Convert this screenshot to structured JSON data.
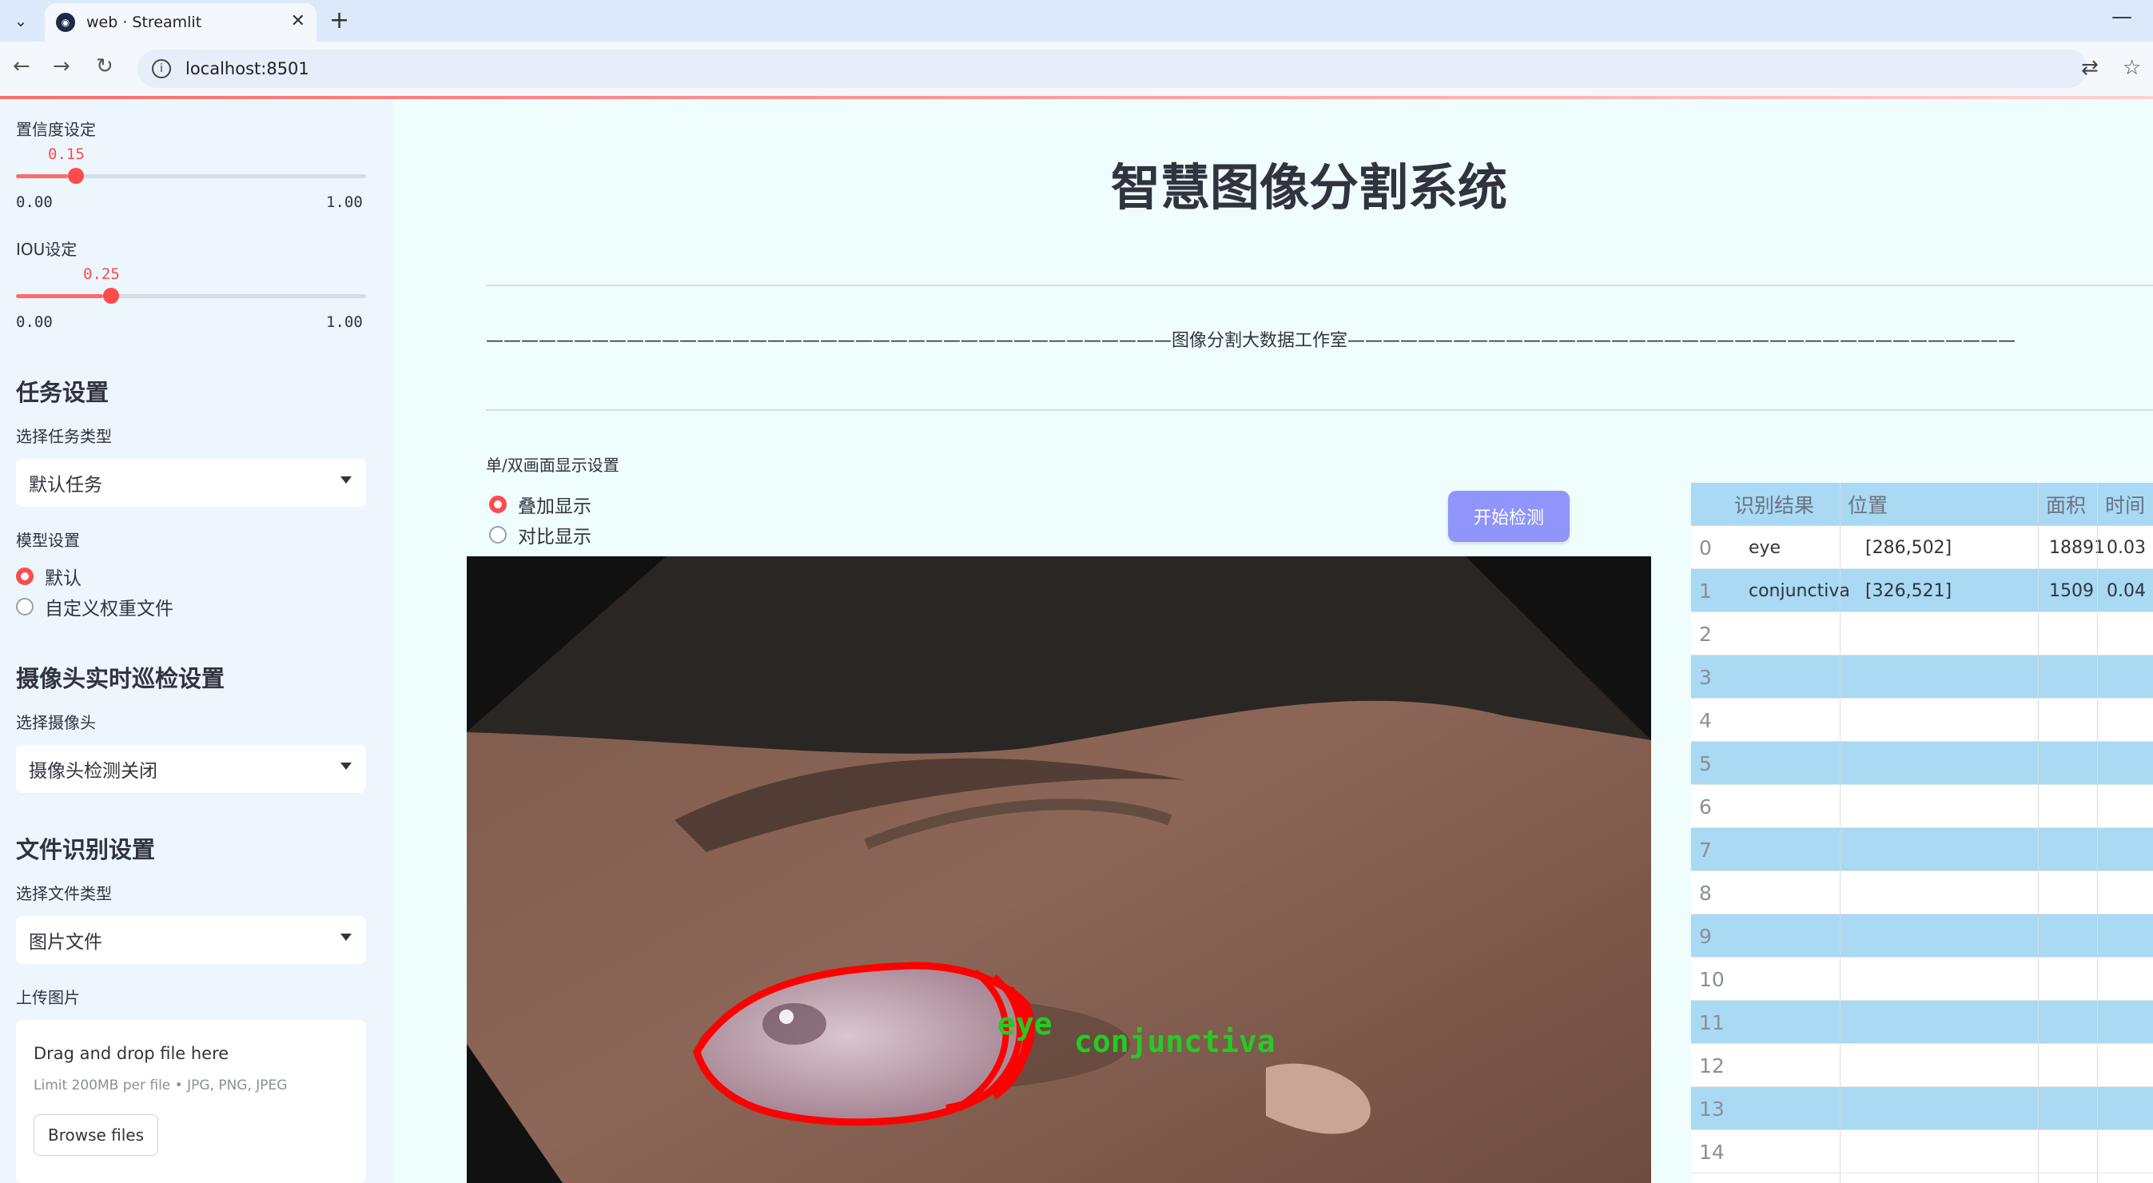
{
  "browser": {
    "tab_title": "web · Streamlit",
    "url": "localhost:8501"
  },
  "sidebar": {
    "confidence": {
      "label": "置信度设定",
      "value": "0.15",
      "value_num": 0.15,
      "min": "0.00",
      "max": "1.00"
    },
    "iou": {
      "label": "IOU设定",
      "value": "0.25",
      "value_num": 0.25,
      "min": "0.00",
      "max": "1.00"
    },
    "task_heading": "任务设置",
    "task_type_label": "选择任务类型",
    "task_type_value": "默认任务",
    "model_label": "模型设置",
    "model_options": [
      "默认",
      "自定义权重文件"
    ],
    "model_selected": "默认",
    "camera_heading": "摄像头实时巡检设置",
    "camera_label": "选择摄像头",
    "camera_value": "摄像头检测关闭",
    "file_heading": "文件识别设置",
    "file_type_label": "选择文件类型",
    "file_type_value": "图片文件",
    "upload_label": "上传图片",
    "uploader": {
      "title": "Drag and drop file here",
      "subtitle": "Limit 200MB per file • JPG, PNG, JPEG",
      "browse": "Browse files"
    }
  },
  "main": {
    "title": "智慧图像分割系统",
    "studio_line": "———————————————————————————————————————图像分割大数据工作室——————————————————————————————————————",
    "display_label": "单/双画面显示设置",
    "display_options": [
      "叠加显示",
      "对比显示"
    ],
    "display_selected": "叠加显示",
    "start_button": "开始检测",
    "image_labels": [
      "eye",
      "conjunctiva"
    ]
  },
  "table": {
    "columns": [
      "识别结果",
      "位置",
      "面积",
      "时间"
    ],
    "row_indices": [
      "0",
      "1",
      "2",
      "3",
      "4",
      "5",
      "6",
      "7",
      "8",
      "9",
      "10",
      "11",
      "12",
      "13",
      "14"
    ],
    "rows": [
      {
        "label": "eye",
        "position": "[286,502]",
        "area": "18891",
        "time": "0.03"
      },
      {
        "label": "conjunctiva",
        "position": "[326,521]",
        "area": "1509",
        "time": "0.04"
      }
    ]
  },
  "colors": {
    "accent": "#ff4b4b",
    "button": "#8f95fb",
    "table_stripe": "#a9d9f3",
    "mask_outline": "#ff0000",
    "label_text": "#22cc22"
  }
}
